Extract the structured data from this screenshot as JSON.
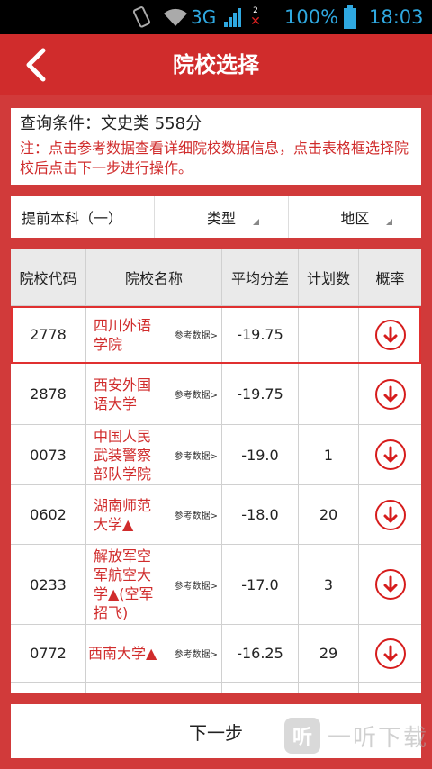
{
  "status_bar": {
    "network": "3G",
    "sim2_label": "2",
    "battery": "100%",
    "time": "18:03"
  },
  "header": {
    "title": "院校选择",
    "back_icon": "chevron-left-icon"
  },
  "info": {
    "query": "查询条件：文史类 558分",
    "note": "注：点击参考数据查看详细院校数据信息，点击表格框选择院校后点击下一步进行操作。"
  },
  "filters": [
    {
      "label": "提前本科（一）"
    },
    {
      "label": "类型"
    },
    {
      "label": "地区"
    }
  ],
  "table": {
    "headers": [
      "院校代码",
      "院校名称",
      "平均分差",
      "计划数",
      "概率"
    ],
    "ref_label": "参考数据>",
    "rows": [
      {
        "code": "2778",
        "name": "四川外语学院",
        "diff": "-19.75",
        "plan": "",
        "selected": true
      },
      {
        "code": "2878",
        "name": "西安外国语大学",
        "diff": "-19.75",
        "plan": "",
        "selected": false
      },
      {
        "code": "0073",
        "name": "中国人民武装警察部队学院",
        "diff": "-19.0",
        "plan": "1",
        "selected": false
      },
      {
        "code": "0602",
        "name": "湖南师范大学▲",
        "diff": "-18.0",
        "plan": "20",
        "selected": false
      },
      {
        "code": "0233",
        "name": "解放军空军航空大学▲(空军招飞)",
        "diff": "-17.0",
        "plan": "3",
        "selected": false
      },
      {
        "code": "0772",
        "name": "西南大学▲",
        "diff": "-16.25",
        "plan": "29",
        "selected": false
      }
    ]
  },
  "next_button": "下一步",
  "watermark": "一听下载",
  "colors": {
    "brand_red": "#d02c2c",
    "accent_blue": "#2fa8e0"
  }
}
